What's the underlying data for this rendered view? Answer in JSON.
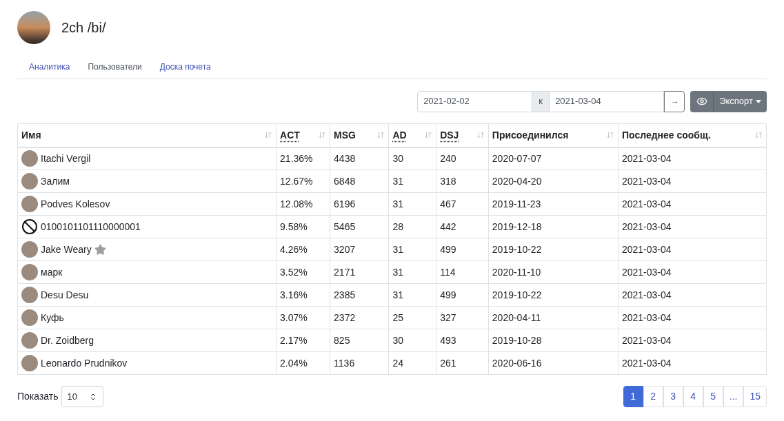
{
  "header": {
    "title": "2ch /bi/"
  },
  "tabs": [
    {
      "label": "Аналитика",
      "selected": false
    },
    {
      "label": "Пользователи",
      "selected": true
    },
    {
      "label": "Доска почета",
      "selected": false
    }
  ],
  "toolbar": {
    "date_from": "2021-02-02",
    "separator": "к",
    "date_to": "2021-03-04",
    "apply": "→",
    "export": "Экспорт"
  },
  "table": {
    "columns": [
      {
        "label": "Имя",
        "abbr": false
      },
      {
        "label": "ACT",
        "abbr": true
      },
      {
        "label": "MSG",
        "abbr": false
      },
      {
        "label": "AD",
        "abbr": true
      },
      {
        "label": "DSJ",
        "abbr": true
      },
      {
        "label": "Присоединился",
        "abbr": false
      },
      {
        "label": "Последнее сообщ.",
        "abbr": false
      }
    ],
    "rows": [
      {
        "kind": "photo",
        "starred": false,
        "cells": [
          "Itachi Vergil",
          "21.36%",
          "4438",
          "30",
          "240",
          "2020-07-07",
          "2021-03-04"
        ]
      },
      {
        "kind": "photo",
        "starred": false,
        "cells": [
          "Залим",
          "12.67%",
          "6848",
          "31",
          "318",
          "2020-04-20",
          "2021-03-04"
        ]
      },
      {
        "kind": "photo",
        "starred": false,
        "cells": [
          "Podves Kolesov",
          "12.08%",
          "6196",
          "31",
          "467",
          "2019-11-23",
          "2021-03-04"
        ]
      },
      {
        "kind": "blocked",
        "starred": false,
        "cells": [
          "0100101101110000001",
          "9.58%",
          "5465",
          "28",
          "442",
          "2019-12-18",
          "2021-03-04"
        ]
      },
      {
        "kind": "photo",
        "starred": true,
        "cells": [
          "Jake Weary",
          "4.26%",
          "3207",
          "31",
          "499",
          "2019-10-22",
          "2021-03-04"
        ]
      },
      {
        "kind": "photo",
        "starred": false,
        "cells": [
          "марк",
          "3.52%",
          "2171",
          "31",
          "114",
          "2020-11-10",
          "2021-03-04"
        ]
      },
      {
        "kind": "photo",
        "starred": false,
        "cells": [
          "Desu Desu",
          "3.16%",
          "2385",
          "31",
          "499",
          "2019-10-22",
          "2021-03-04"
        ]
      },
      {
        "kind": "photo",
        "starred": false,
        "cells": [
          "Куфь",
          "3.07%",
          "2372",
          "25",
          "327",
          "2020-04-11",
          "2021-03-04"
        ]
      },
      {
        "kind": "photo",
        "starred": false,
        "cells": [
          "Dr. Zoidberg",
          "2.17%",
          "825",
          "30",
          "493",
          "2019-10-28",
          "2021-03-04"
        ]
      },
      {
        "kind": "photo",
        "starred": false,
        "cells": [
          "Leonardo Prudnikov",
          "2.04%",
          "1136",
          "24",
          "261",
          "2020-06-16",
          "2021-03-04"
        ]
      }
    ]
  },
  "footer": {
    "show_label": "Показать",
    "page_size": "10",
    "pages": [
      {
        "label": "1",
        "selected": true
      },
      {
        "label": "2",
        "selected": false
      },
      {
        "label": "3",
        "selected": false
      },
      {
        "label": "4",
        "selected": false
      },
      {
        "label": "5",
        "selected": false
      },
      {
        "label": "...",
        "selected": false
      },
      {
        "label": "15",
        "selected": false
      }
    ]
  }
}
